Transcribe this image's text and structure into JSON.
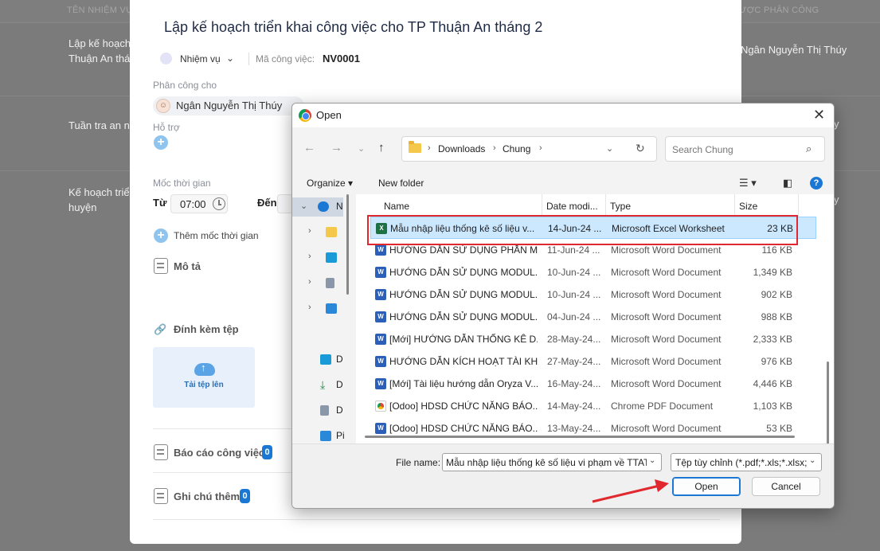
{
  "background": {
    "col_task_name": "TÊN NHIỆM VỤ",
    "col_assignee": "ƯỢC PHÂN CÔNG",
    "rows": [
      {
        "name_line1": "Lập kế hoạch",
        "name_line2": "Thuận An thán",
        "assignee": "Ngân Nguyễn Thị Thúy"
      },
      {
        "name_line1": "Tuần tra an ni",
        "name_line2": "",
        "assignee": "y"
      },
      {
        "name_line1": "Kế hoạch triển",
        "name_line2": "huyện",
        "assignee": "y"
      }
    ]
  },
  "panel": {
    "title": "Lập kế hoạch triển khai công việc cho TP Thuận An tháng 2",
    "type_label": "Nhiệm vụ",
    "code_label": "Mã công việc:",
    "code_value": "NV0001",
    "assigned_label": "Phân công cho",
    "assigned_name": "Ngân Nguyễn Thị Thúy",
    "support_label": "Hỗ trợ",
    "milestone_label": "Mốc thời gian",
    "from_label": "Từ",
    "from_time": "07:00",
    "to_label": "Đến",
    "add_milestone": "Thêm mốc thời gian",
    "description_label": "Mô tả",
    "attach_label": "Đính kèm tệp",
    "upload_label": "Tải tệp lên",
    "report_label": "Báo cáo công việc",
    "report_count": "0",
    "notes_label": "Ghi chú thêm",
    "notes_count": "0"
  },
  "dialog": {
    "title": "Open",
    "breadcrumb": [
      "Downloads",
      "Chung"
    ],
    "search_placeholder": "Search Chung",
    "organize": "Organize",
    "new_folder": "New folder",
    "nav_items": [
      {
        "label": "N",
        "icon": "onedrive-icon"
      },
      {
        "label": "",
        "icon": "folder-icon"
      },
      {
        "label": "",
        "icon": "desktop-icon"
      },
      {
        "label": "",
        "icon": "document-icon"
      },
      {
        "label": "",
        "icon": "pictures-icon"
      },
      {
        "label": "D",
        "icon": "desktop-icon"
      },
      {
        "label": "D",
        "icon": "download-icon"
      },
      {
        "label": "D",
        "icon": "document-icon"
      },
      {
        "label": "Pi",
        "icon": "pictures-icon"
      }
    ],
    "columns": {
      "name": "Name",
      "date": "Date modi...",
      "type": "Type",
      "size": "Size"
    },
    "files": [
      {
        "name": "Mẫu nhập liệu thống kê số liệu v...",
        "date": "14-Jun-24 ...",
        "type": "Microsoft Excel Worksheet",
        "size": "23 KB",
        "icon": "excel"
      },
      {
        "name": "HƯỚNG DẪN SỬ DỤNG PHẦN M...",
        "date": "11-Jun-24 ...",
        "type": "Microsoft Word Document",
        "size": "116 KB",
        "icon": "word"
      },
      {
        "name": "HƯỚNG DẪN SỬ DỤNG MODUL...",
        "date": "10-Jun-24 ...",
        "type": "Microsoft Word Document",
        "size": "1,349 KB",
        "icon": "word"
      },
      {
        "name": "HƯỚNG DẪN SỬ DỤNG MODUL...",
        "date": "10-Jun-24 ...",
        "type": "Microsoft Word Document",
        "size": "902 KB",
        "icon": "word"
      },
      {
        "name": "HƯỚNG DẪN SỬ DỤNG MODUL...",
        "date": "04-Jun-24 ...",
        "type": "Microsoft Word Document",
        "size": "988 KB",
        "icon": "word"
      },
      {
        "name": "[Mới] HƯỚNG DẪN THỐNG KÊ D...",
        "date": "28-May-24...",
        "type": "Microsoft Word Document",
        "size": "2,333 KB",
        "icon": "word"
      },
      {
        "name": "HƯỚNG DẪN KÍCH HOẠT TÀI KH...",
        "date": "27-May-24...",
        "type": "Microsoft Word Document",
        "size": "976 KB",
        "icon": "word"
      },
      {
        "name": "[Mới] Tài liệu hướng dẫn Oryza V...",
        "date": "16-May-24...",
        "type": "Microsoft Word Document",
        "size": "4,446 KB",
        "icon": "word"
      },
      {
        "name": "[Odoo] HDSD CHỨC NĂNG BÁO...",
        "date": "14-May-24...",
        "type": "Chrome PDF Document",
        "size": "1,103 KB",
        "icon": "pdf"
      },
      {
        "name": "[Odoo] HDSD CHỨC NĂNG BÁO...",
        "date": "13-May-24...",
        "type": "Microsoft Word Document",
        "size": "53 KB",
        "icon": "word"
      }
    ],
    "file_name_label": "File name:",
    "file_name_value": "Mẫu nhập liệu thống kê số liệu vi phạm về TTATGT",
    "file_type_value": "Tệp tùy chỉnh (*.pdf;*.xls;*.xlsx;",
    "open_button": "Open",
    "cancel_button": "Cancel"
  },
  "colors": {
    "highlight": "#e0282e",
    "accent": "#1a78d4"
  }
}
